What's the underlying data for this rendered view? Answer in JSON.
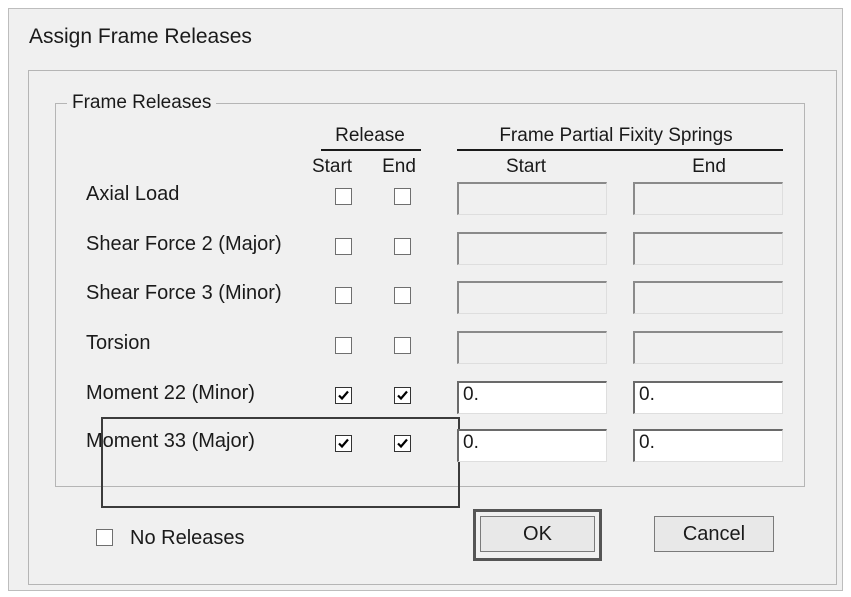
{
  "dialog": {
    "title": "Assign Frame Releases"
  },
  "group": {
    "label": "Frame Releases"
  },
  "headers": {
    "release": "Release",
    "release_start": "Start",
    "release_end": "End",
    "springs": "Frame Partial Fixity Springs",
    "springs_start": "Start",
    "springs_end": "End"
  },
  "rows": [
    {
      "label": "Axial Load",
      "start_checked": false,
      "end_checked": false,
      "start_value": "",
      "end_value": "",
      "enabled": false
    },
    {
      "label": "Shear Force 2 (Major)",
      "start_checked": false,
      "end_checked": false,
      "start_value": "",
      "end_value": "",
      "enabled": false
    },
    {
      "label": "Shear Force 3 (Minor)",
      "start_checked": false,
      "end_checked": false,
      "start_value": "",
      "end_value": "",
      "enabled": false
    },
    {
      "label": "Torsion",
      "start_checked": false,
      "end_checked": false,
      "start_value": "",
      "end_value": "",
      "enabled": false
    },
    {
      "label": "Moment 22 (Minor)",
      "start_checked": true,
      "end_checked": true,
      "start_value": "0.",
      "end_value": "0.",
      "enabled": true
    },
    {
      "label": "Moment 33 (Major)",
      "start_checked": true,
      "end_checked": true,
      "start_value": "0.",
      "end_value": "0.",
      "enabled": true
    }
  ],
  "no_releases": {
    "label": "No Releases",
    "checked": false
  },
  "buttons": {
    "ok": "OK",
    "cancel": "Cancel"
  },
  "icons": {
    "checkmark": "check-icon"
  }
}
